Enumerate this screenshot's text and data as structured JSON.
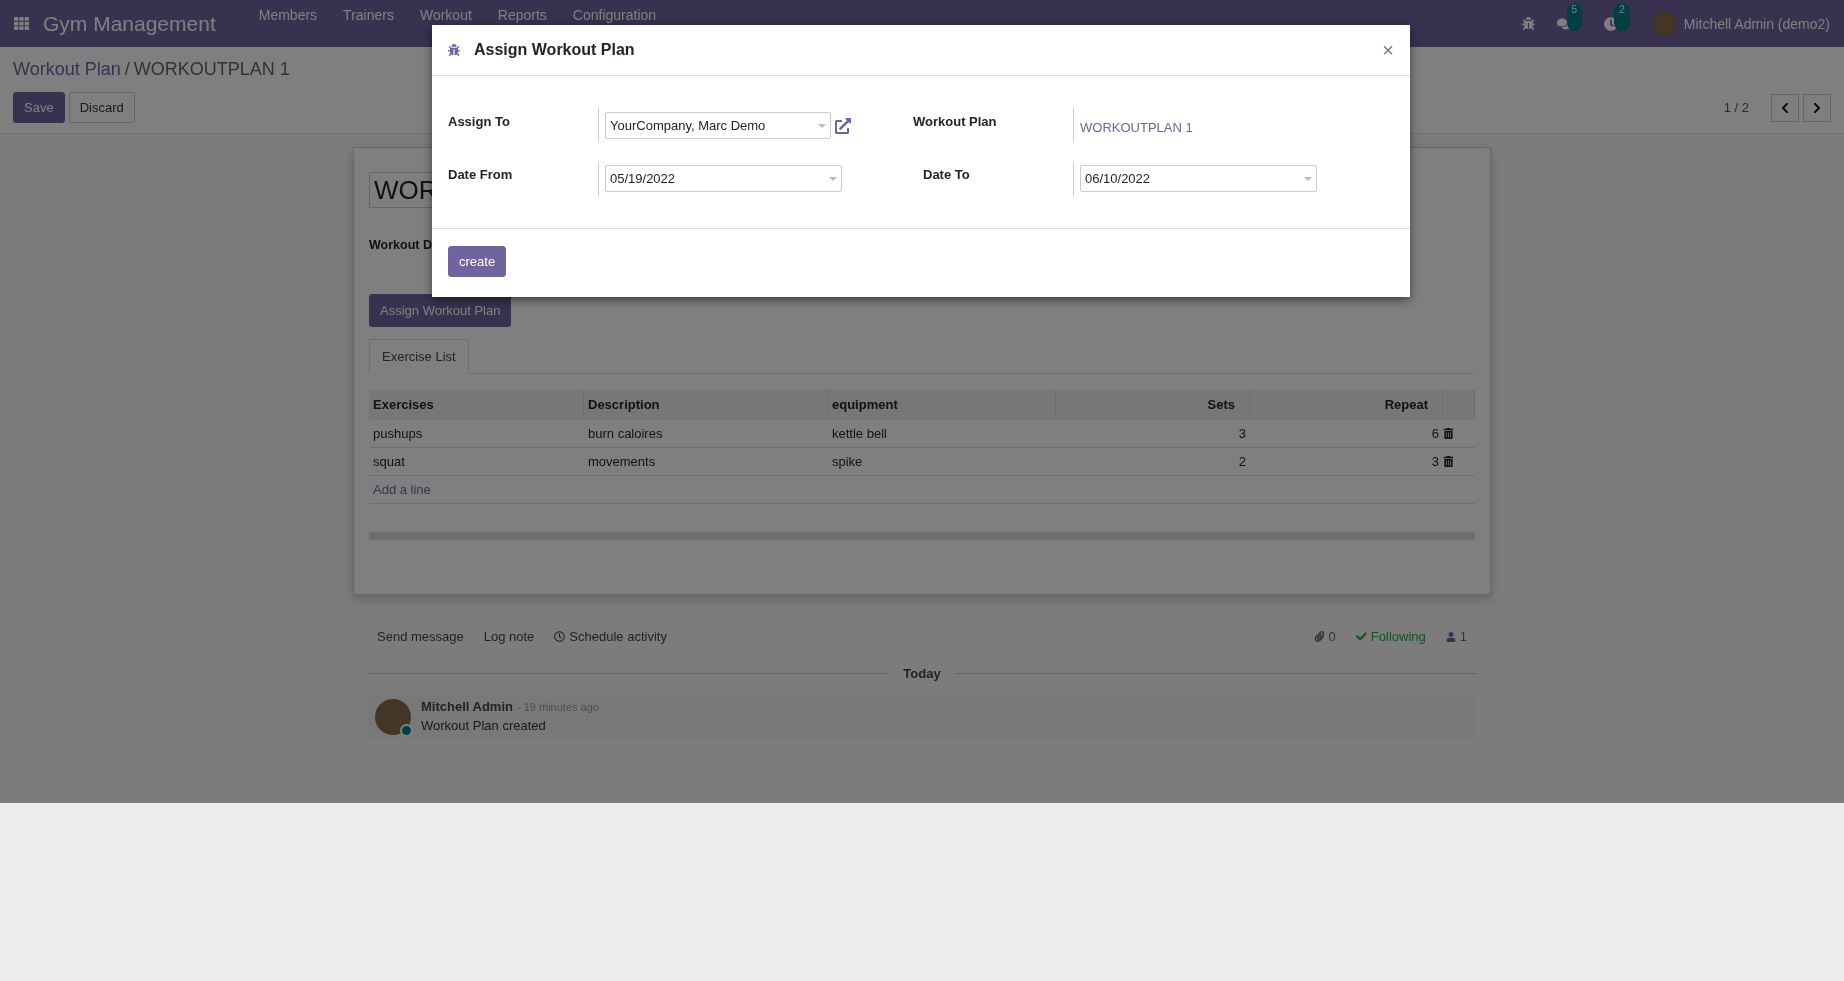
{
  "navbar": {
    "app_name": "Gym Management",
    "menus": [
      "Members",
      "Trainers",
      "Workout",
      "Reports",
      "Configuration"
    ],
    "messages_count": "5",
    "activities_count": "2",
    "user": "Mitchell Admin (demo2)"
  },
  "breadcrumb": {
    "parent": "Workout Plan",
    "separator": "/",
    "current": "WORKOUTPLAN 1"
  },
  "buttons": [
    "Save",
    "Discard"
  ],
  "pager": "1 / 2",
  "form": {
    "title": "WOR",
    "field_label": "Workout D",
    "action_button": "Assign Workout Plan",
    "tabs": [
      {
        "label": "Exercise List",
        "selected": true
      }
    ],
    "columns": [
      {
        "label": "Exercises",
        "kind": "text"
      },
      {
        "label": "Description",
        "kind": "text"
      },
      {
        "label": "equipment",
        "kind": "text"
      },
      {
        "label": "Sets",
        "kind": "number"
      },
      {
        "label": "Repeat",
        "kind": "number"
      }
    ],
    "rows": [
      [
        "pushups",
        "burn caloires",
        "kettle bell",
        "3",
        "6"
      ],
      [
        "squat",
        "movements",
        "spike",
        "2",
        "3"
      ]
    ],
    "add_line": "Add a line"
  },
  "chatter": {
    "actions": [
      "Send message",
      "Log note",
      "Schedule activity"
    ],
    "attachments": "0",
    "following": "Following",
    "followers": "1",
    "divider": "Today",
    "message": {
      "author": "Mitchell Admin",
      "time": "- 19 minutes ago",
      "body": "Workout Plan created"
    }
  },
  "dialog": {
    "title": "Assign Workout Plan",
    "close": "×",
    "assign_to_label": "Assign To",
    "assign_to": "YourCompany, Marc Demo",
    "plan_label": "Workout Plan",
    "plan": "WORKOUTPLAN 1",
    "date_from_label": "Date From",
    "date_from": "05/19/2022",
    "date_to_label": "Date To",
    "date_to": "06/10/2022",
    "create": "create"
  }
}
